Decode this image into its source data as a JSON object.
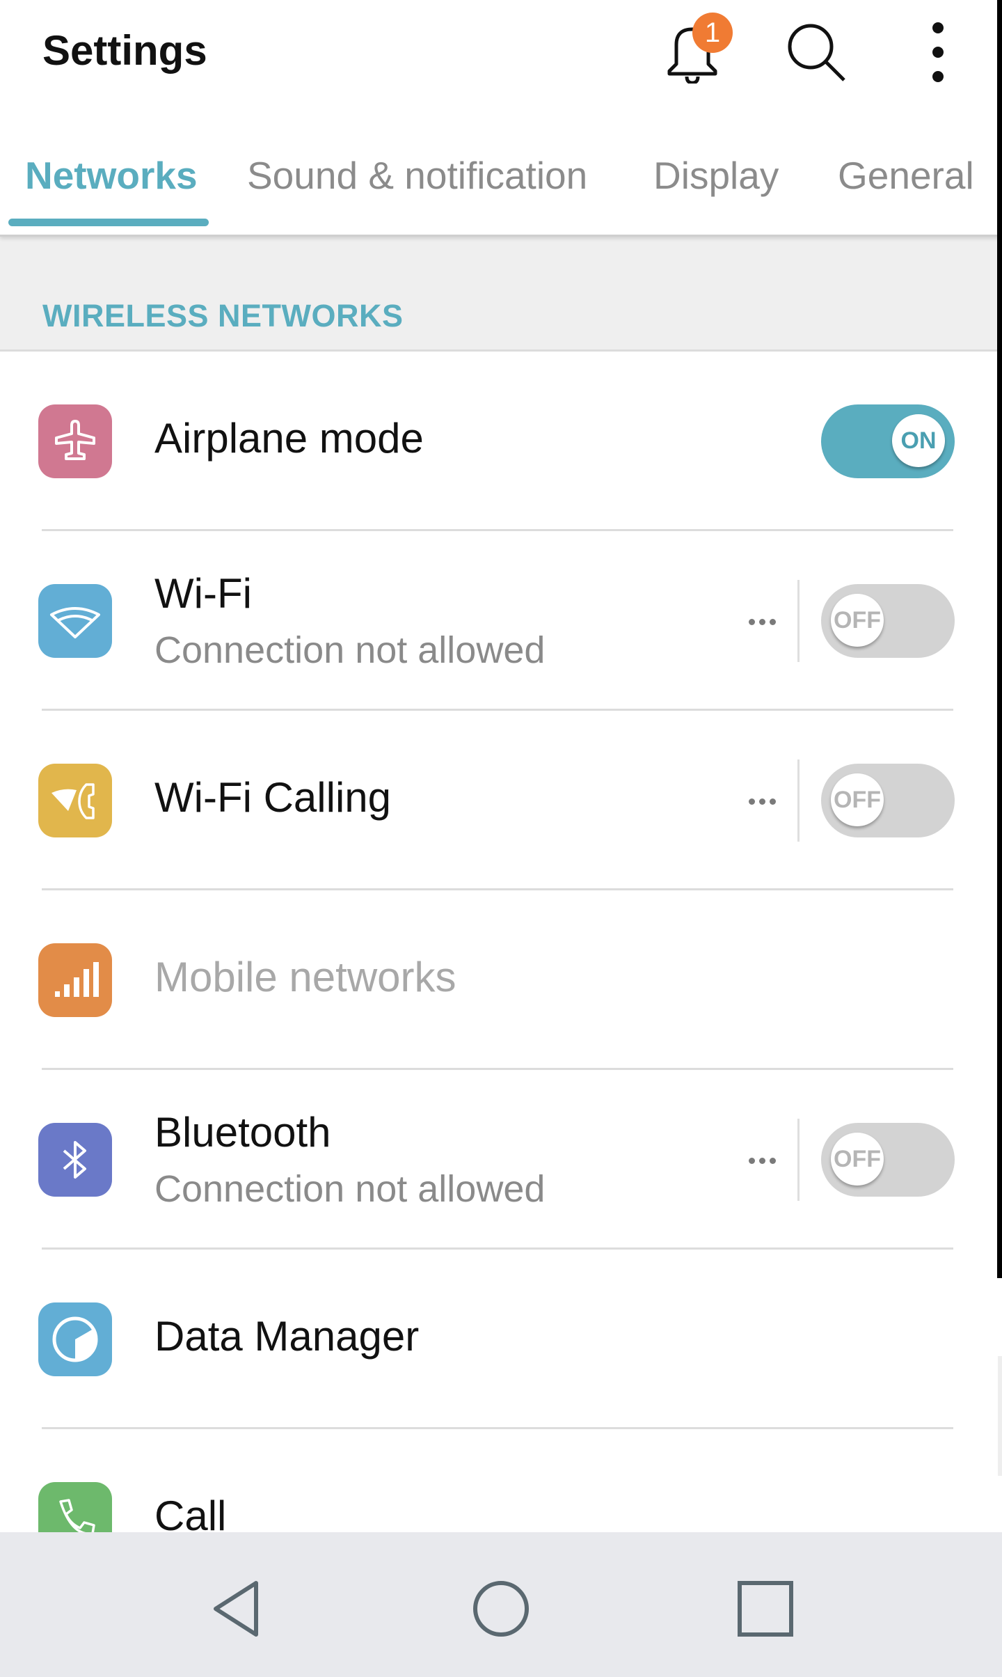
{
  "header": {
    "title": "Settings",
    "notification_count": "1",
    "icons": [
      "bell-icon",
      "search-icon",
      "more-vert-icon"
    ]
  },
  "tabs": [
    {
      "label": "Networks",
      "active": true
    },
    {
      "label": "Sound & notification",
      "active": false
    },
    {
      "label": "Display",
      "active": false
    },
    {
      "label": "General",
      "active": false
    }
  ],
  "section": {
    "label": "WIRELESS NETWORKS"
  },
  "rows": [
    {
      "title": "Airplane mode",
      "subtitle": null,
      "icon": "airplane-icon",
      "icon_color": "#d07891",
      "toggle": "ON",
      "more": false
    },
    {
      "title": "Wi-Fi",
      "subtitle": "Connection not allowed",
      "icon": "wifi-icon",
      "icon_color": "#62aed5",
      "toggle": "OFF",
      "more": true
    },
    {
      "title": "Wi-Fi Calling",
      "subtitle": null,
      "icon": "wifi-calling-icon",
      "icon_color": "#e1b64c",
      "toggle": "OFF",
      "more": true
    },
    {
      "title": "Mobile networks",
      "subtitle": null,
      "icon": "signal-bars-icon",
      "icon_color": "#e28c48",
      "toggle": null,
      "more": false,
      "disabled": true
    },
    {
      "title": "Bluetooth",
      "subtitle": "Connection not allowed",
      "icon": "bluetooth-icon",
      "icon_color": "#6a79c8",
      "toggle": "OFF",
      "more": true
    },
    {
      "title": "Data Manager",
      "subtitle": null,
      "icon": "data-usage-icon",
      "icon_color": "#62aed5",
      "toggle": null,
      "more": false
    },
    {
      "title": "Call",
      "subtitle": null,
      "icon": "phone-icon",
      "icon_color": "#6db96c",
      "toggle": null,
      "more": false
    }
  ],
  "colors": {
    "accent": "#5aadbf",
    "badge": "#f07b33",
    "toggle_off": "#d3d3d3",
    "navbar_bg": "#e8e9ed"
  },
  "navbar": {
    "buttons": [
      "back",
      "home",
      "recents"
    ]
  }
}
